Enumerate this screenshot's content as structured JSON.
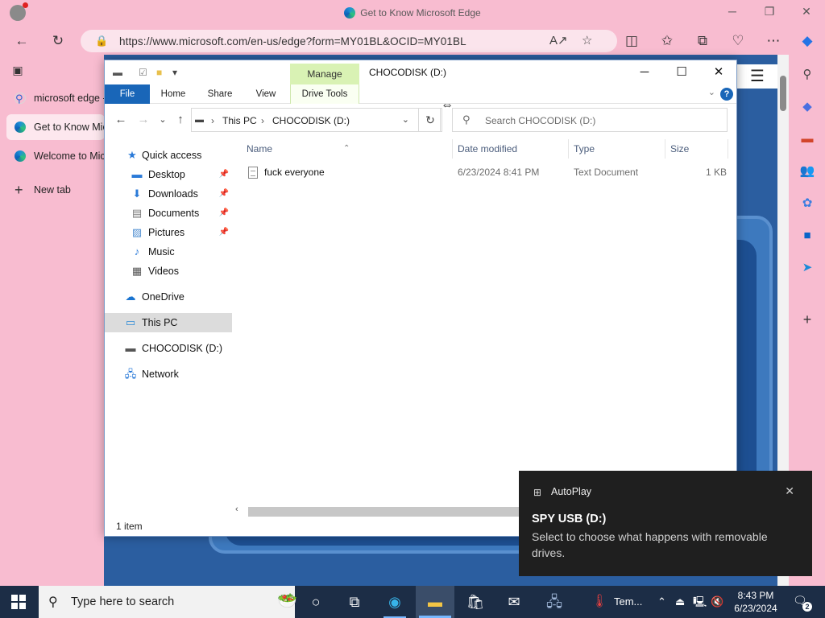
{
  "browser": {
    "window_title": "Get to Know Microsoft Edge",
    "url": "https://www.microsoft.com/en-us/edge?form=MY01BL&OCID=MY01BL",
    "tabs": [
      {
        "label": "microsoft edge -"
      },
      {
        "label": "Get to Know Mic"
      },
      {
        "label": "Welcome to Mic"
      }
    ],
    "new_tab_label": "New tab"
  },
  "explorer": {
    "title": "CHOCODISK (D:)",
    "context_tab": "Manage",
    "ribbon_tabs": [
      "File",
      "Home",
      "Share",
      "View",
      "Drive Tools"
    ],
    "breadcrumb": [
      "This PC",
      "CHOCODISK (D:)"
    ],
    "search_placeholder": "Search CHOCODISK (D:)",
    "nav": {
      "quick_access": "Quick access",
      "desktop": "Desktop",
      "downloads": "Downloads",
      "documents": "Documents",
      "pictures": "Pictures",
      "music": "Music",
      "videos": "Videos",
      "onedrive": "OneDrive",
      "this_pc": "This PC",
      "chocodisk": "CHOCODISK (D:)",
      "network": "Network"
    },
    "columns": {
      "name": "Name",
      "date": "Date modified",
      "type": "Type",
      "size": "Size"
    },
    "files": [
      {
        "name": "fuck everyone",
        "date": "6/23/2024 8:41 PM",
        "type": "Text Document",
        "size": "1 KB"
      }
    ],
    "status": "1 item"
  },
  "toast": {
    "app": "AutoPlay",
    "title": "SPY USB (D:)",
    "message": "Select to choose what happens with removable drives."
  },
  "taskbar": {
    "search_placeholder": "Type here to search",
    "weather_label": "Tem...",
    "time": "8:43 PM",
    "date": "6/23/2024",
    "notification_count": "2"
  }
}
